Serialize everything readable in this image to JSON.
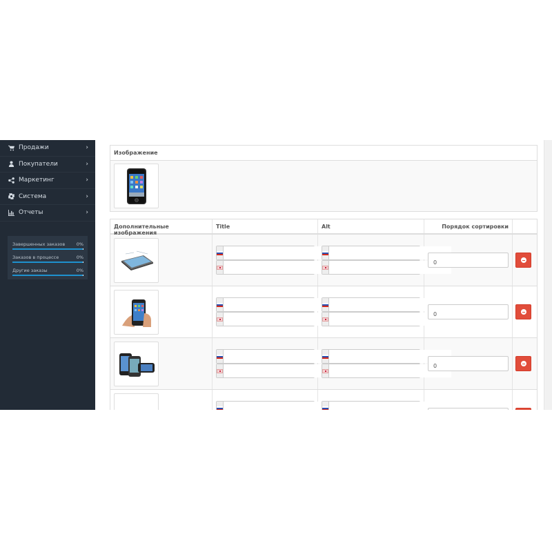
{
  "sidebar": {
    "items": [
      {
        "label": "Продажи",
        "icon": "shopping-cart-icon"
      },
      {
        "label": "Покупатели",
        "icon": "user-icon"
      },
      {
        "label": "Маркетинг",
        "icon": "share-icon"
      },
      {
        "label": "Система",
        "icon": "gear-icon"
      },
      {
        "label": "Отчеты",
        "icon": "bar-chart-icon"
      }
    ],
    "stats": [
      {
        "label": "Завершенных заказов",
        "value": "0%",
        "progress": 0.99
      },
      {
        "label": "Заказов в процессе",
        "value": "0%",
        "progress": 0.99
      },
      {
        "label": "Другие заказы",
        "value": "0%",
        "progress": 0.99
      }
    ]
  },
  "image_panel": {
    "header": "Изображение"
  },
  "additional_images": {
    "columns": {
      "image": "Дополнительные изображения",
      "title": "Title",
      "alt": "Alt",
      "sort_order": "Порядок сортировки"
    },
    "rows": [
      {
        "sort_order": "0"
      },
      {
        "sort_order": "0"
      },
      {
        "sort_order": "0"
      },
      {
        "sort_order": ""
      }
    ]
  },
  "colors": {
    "sidebar_bg": "#222b36",
    "danger": "#e14d3b",
    "progress": "#1e91cf"
  }
}
